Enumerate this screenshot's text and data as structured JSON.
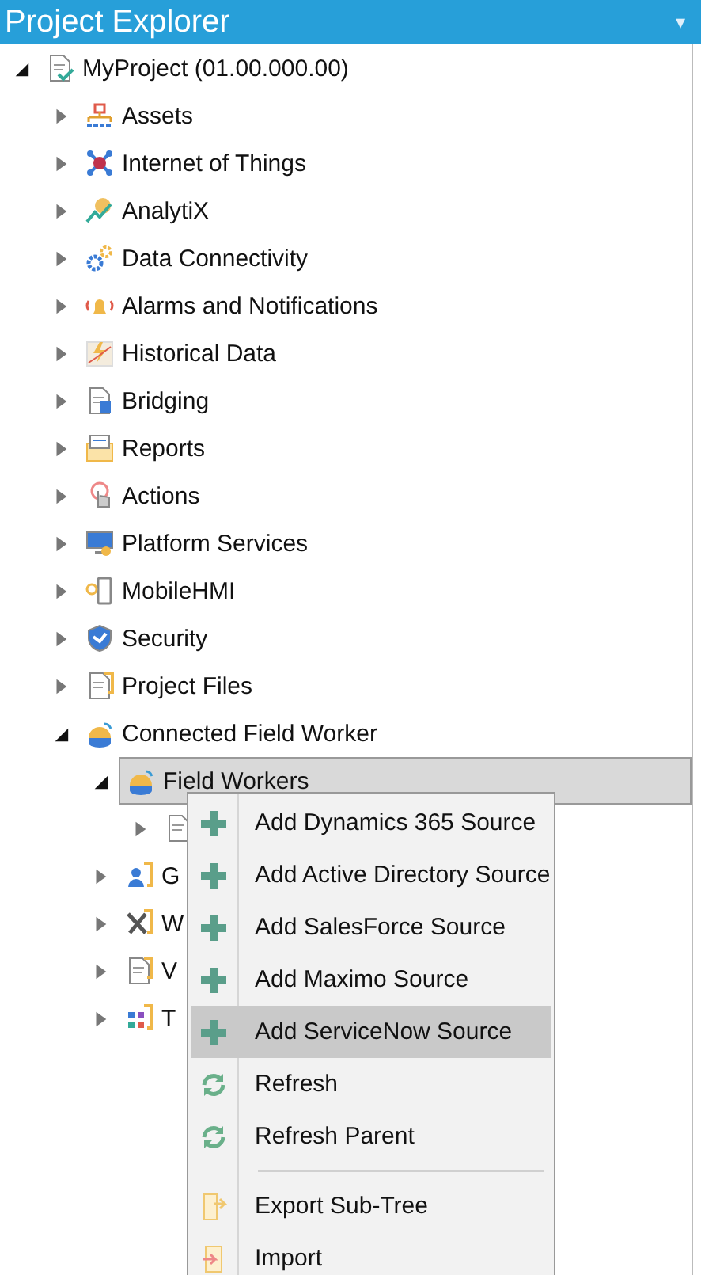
{
  "panel": {
    "title": "Project Explorer",
    "menu_glyph": "▾"
  },
  "tree": {
    "label": "MyProject (01.00.000.00)",
    "expanded": true,
    "selected": false,
    "children": [
      {
        "label": "Assets",
        "expanded": false,
        "selected": false
      },
      {
        "label": "Internet of Things",
        "expanded": false,
        "selected": false
      },
      {
        "label": "AnalytiX",
        "expanded": false,
        "selected": false
      },
      {
        "label": "Data Connectivity",
        "expanded": false,
        "selected": false
      },
      {
        "label": "Alarms and Notifications",
        "expanded": false,
        "selected": false
      },
      {
        "label": "Historical Data",
        "expanded": false,
        "selected": false
      },
      {
        "label": "Bridging",
        "expanded": false,
        "selected": false
      },
      {
        "label": "Reports",
        "expanded": false,
        "selected": false
      },
      {
        "label": "Actions",
        "expanded": false,
        "selected": false
      },
      {
        "label": "Platform Services",
        "expanded": false,
        "selected": false
      },
      {
        "label": "MobileHMI",
        "expanded": false,
        "selected": false
      },
      {
        "label": "Security",
        "expanded": false,
        "selected": false
      },
      {
        "label": "Project Files",
        "expanded": false,
        "selected": false
      },
      {
        "label": "Connected Field Worker",
        "expanded": true,
        "selected": false,
        "children": [
          {
            "label": "Field Workers",
            "expanded": true,
            "selected": true,
            "children": [
              {
                "expanded": false,
                "selected": false
              }
            ]
          },
          {
            "label": "G",
            "expanded": false,
            "selected": false
          },
          {
            "label": "W",
            "expanded": false,
            "selected": false
          },
          {
            "label": "V",
            "expanded": false,
            "selected": false
          },
          {
            "label": "T",
            "expanded": false,
            "selected": false
          }
        ]
      }
    ]
  },
  "context_menu": {
    "groups": [
      [
        {
          "label": "Add Dynamics 365 Source",
          "kind": "add",
          "selected": false
        },
        {
          "label": "Add Active Directory Source",
          "kind": "add",
          "selected": false
        },
        {
          "label": "Add SalesForce Source",
          "kind": "add",
          "selected": false
        },
        {
          "label": "Add Maximo Source",
          "kind": "add",
          "selected": false
        },
        {
          "label": "Add ServiceNow Source",
          "kind": "add",
          "selected": true
        },
        {
          "label": "Refresh",
          "kind": "refresh",
          "selected": false
        },
        {
          "label": "Refresh Parent",
          "kind": "refresh",
          "selected": false
        }
      ],
      [
        {
          "label": "Export Sub-Tree",
          "kind": "export",
          "selected": false
        },
        {
          "label": "Import",
          "kind": "import",
          "selected": false
        }
      ]
    ]
  }
}
